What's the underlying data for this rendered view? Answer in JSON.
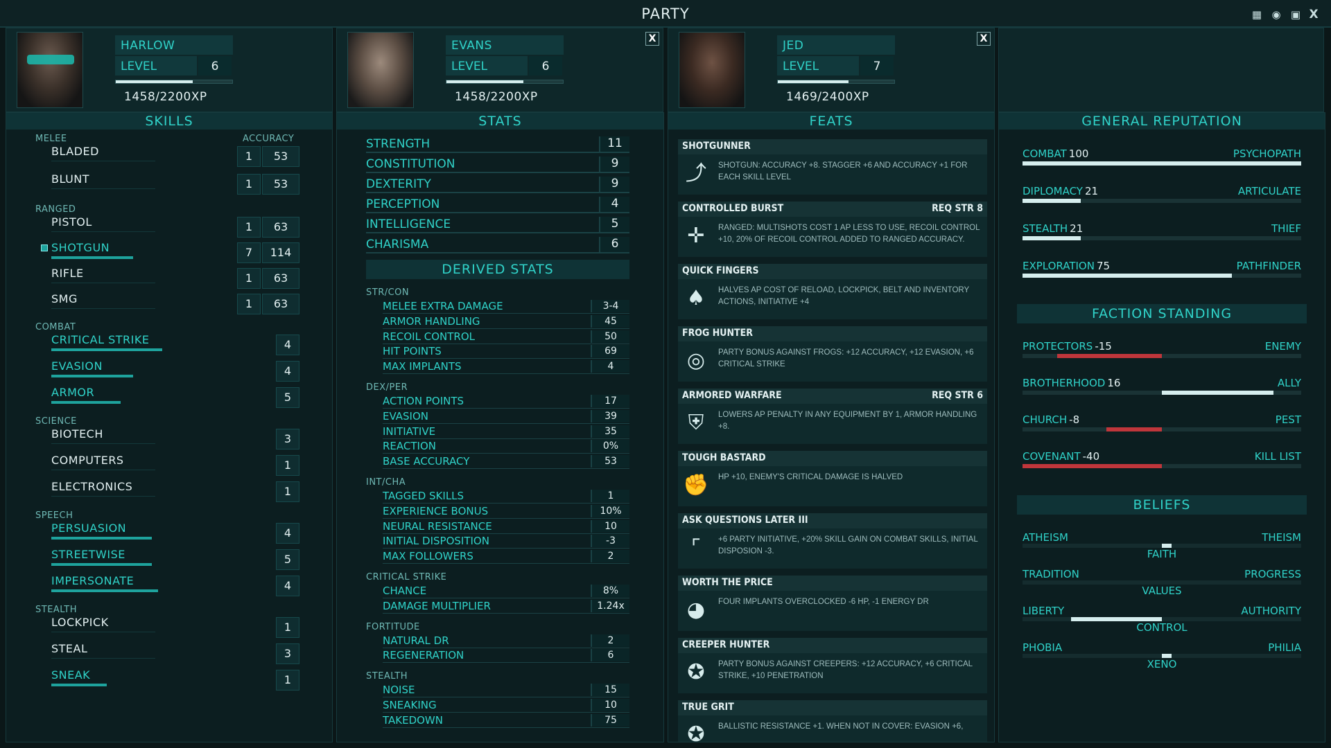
{
  "window": {
    "title": "PARTY",
    "icons": [
      "calendar-icon",
      "brain-icon",
      "monitor-icon",
      "close-icon"
    ],
    "close_label": "X"
  },
  "party": [
    {
      "name": "HARLOW",
      "level_label": "LEVEL",
      "level": "6",
      "xp": "1458/2200XP",
      "xp_fraction": 0.66
    },
    {
      "name": "EVANS",
      "level_label": "LEVEL",
      "level": "6",
      "xp": "1458/2200XP",
      "xp_fraction": 0.66,
      "close": "X"
    },
    {
      "name": "JED",
      "level_label": "LEVEL",
      "level": "7",
      "xp": "1469/2400XP",
      "xp_fraction": 0.61,
      "close": "X"
    }
  ],
  "skills": {
    "title": "SKILLS",
    "accuracy_label": "ACCURACY",
    "groups": [
      {
        "name": "MELEE",
        "items": [
          {
            "label": "BLADED",
            "value": "1",
            "accuracy": "53",
            "tagged": false
          },
          {
            "label": "BLUNT",
            "value": "1",
            "accuracy": "53",
            "tagged": false
          }
        ]
      },
      {
        "name": "RANGED",
        "items": [
          {
            "label": "PISTOL",
            "value": "1",
            "accuracy": "63",
            "tagged": false
          },
          {
            "label": "SHOTGUN",
            "value": "7",
            "accuracy": "114",
            "tagged": true
          },
          {
            "label": "RIFLE",
            "value": "1",
            "accuracy": "63",
            "tagged": false
          },
          {
            "label": "SMG",
            "value": "1",
            "accuracy": "63",
            "tagged": false
          }
        ]
      },
      {
        "name": "COMBAT",
        "items": [
          {
            "label": "CRITICAL STRIKE",
            "value": "4",
            "tagged": true
          },
          {
            "label": "EVASION",
            "value": "4",
            "tagged": true
          },
          {
            "label": "ARMOR",
            "value": "5",
            "tagged": true
          }
        ]
      },
      {
        "name": "SCIENCE",
        "items": [
          {
            "label": "BIOTECH",
            "value": "3",
            "tagged": false
          },
          {
            "label": "COMPUTERS",
            "value": "1",
            "tagged": false
          },
          {
            "label": "ELECTRONICS",
            "value": "1",
            "tagged": false
          }
        ]
      },
      {
        "name": "SPEECH",
        "items": [
          {
            "label": "PERSUASION",
            "value": "4",
            "tagged": true
          },
          {
            "label": "STREETWISE",
            "value": "5",
            "tagged": true
          },
          {
            "label": "IMPERSONATE",
            "value": "4",
            "tagged": true
          }
        ]
      },
      {
        "name": "STEALTH",
        "items": [
          {
            "label": "LOCKPICK",
            "value": "1",
            "tagged": false
          },
          {
            "label": "STEAL",
            "value": "3",
            "tagged": false
          },
          {
            "label": "SNEAK",
            "value": "1",
            "tagged": true
          }
        ]
      }
    ]
  },
  "stats": {
    "title": "STATS",
    "primary": [
      {
        "label": "STRENGTH",
        "value": "11"
      },
      {
        "label": "CONSTITUTION",
        "value": "9"
      },
      {
        "label": "DEXTERITY",
        "value": "9"
      },
      {
        "label": "PERCEPTION",
        "value": "4"
      },
      {
        "label": "INTELLIGENCE",
        "value": "5"
      },
      {
        "label": "CHARISMA",
        "value": "6"
      }
    ],
    "derived_title": "DERIVED STATS",
    "derived": [
      {
        "group": "STR/CON",
        "items": [
          {
            "label": "MELEE EXTRA DAMAGE",
            "value": "3-4"
          },
          {
            "label": "ARMOR HANDLING",
            "value": "45"
          },
          {
            "label": "RECOIL CONTROL",
            "value": "50"
          },
          {
            "label": "HIT POINTS",
            "value": "69"
          },
          {
            "label": "MAX IMPLANTS",
            "value": "4"
          }
        ]
      },
      {
        "group": "DEX/PER",
        "items": [
          {
            "label": "ACTION POINTS",
            "value": "17"
          },
          {
            "label": "EVASION",
            "value": "39"
          },
          {
            "label": "INITIATIVE",
            "value": "35"
          },
          {
            "label": "REACTION",
            "value": "0%"
          },
          {
            "label": "BASE ACCURACY",
            "value": "53"
          }
        ]
      },
      {
        "group": "INT/CHA",
        "items": [
          {
            "label": "TAGGED SKILLS",
            "value": "1"
          },
          {
            "label": "EXPERIENCE BONUS",
            "value": "10%"
          },
          {
            "label": "NEURAL RESISTANCE",
            "value": "10"
          },
          {
            "label": "INITIAL DISPOSITION",
            "value": "-3"
          },
          {
            "label": "MAX FOLLOWERS",
            "value": "2"
          }
        ]
      },
      {
        "group": "CRITICAL STRIKE",
        "items": [
          {
            "label": "CHANCE",
            "value": "8%"
          },
          {
            "label": "DAMAGE MULTIPLIER",
            "value": "1.24x"
          }
        ]
      },
      {
        "group": "FORTITUDE",
        "items": [
          {
            "label": "NATURAL DR",
            "value": "2"
          },
          {
            "label": "REGENERATION",
            "value": "6"
          }
        ]
      },
      {
        "group": "STEALTH",
        "items": [
          {
            "label": "NOISE",
            "value": "15"
          },
          {
            "label": "SNEAKING",
            "value": "10"
          },
          {
            "label": "TAKEDOWN",
            "value": "75"
          }
        ]
      }
    ]
  },
  "feats": {
    "title": "FEATS",
    "items": [
      {
        "name": "SHOTGUNNER",
        "req": "",
        "icon": "shotgun-icon",
        "desc": "SHOTGUN: ACCURACY +8. STAGGER +6 AND ACCURACY +1 FOR EACH SKILL LEVEL"
      },
      {
        "name": "CONTROLLED BURST",
        "req": "REQ STR 8",
        "icon": "crosshair-icon",
        "desc": "RANGED: MULTISHOTS COST 1 AP LESS TO USE, RECOIL CONTROL +10, 20% OF RECOIL CONTROL ADDED TO RANGED ACCURACY."
      },
      {
        "name": "QUICK FINGERS",
        "req": "",
        "icon": "cards-icon",
        "desc": "HALVES AP COST OF RELOAD, LOCKPICK, BELT AND INVENTORY ACTIONS, INITIATIVE +4"
      },
      {
        "name": "FROG HUNTER",
        "req": "",
        "icon": "frog-target-icon",
        "desc": "PARTY BONUS AGAINST FROGS: +12 ACCURACY, +12 EVASION, +6 CRITICAL STRIKE"
      },
      {
        "name": "ARMORED WARFARE",
        "req": "REQ STR 6",
        "icon": "armor-icon",
        "desc": "LOWERS AP PENALTY IN ANY EQUIPMENT BY 1, ARMOR HANDLING +8."
      },
      {
        "name": "TOUGH BASTARD",
        "req": "",
        "icon": "fist-icon",
        "desc": "HP +10, ENEMY'S CRITICAL DAMAGE IS HALVED"
      },
      {
        "name": "ASK QUESTIONS LATER III",
        "req": "",
        "icon": "pistol-icon",
        "desc": "+6 PARTY INITIATIVE, +20% SKILL GAIN ON COMBAT SKILLS, INITIAL DISPOSION -3."
      },
      {
        "name": "WORTH THE PRICE",
        "req": "",
        "icon": "gauge-icon",
        "desc": "FOUR IMPLANTS OVERCLOCKED -6 HP, -1 ENERGY DR"
      },
      {
        "name": "CREEPER HUNTER",
        "req": "",
        "icon": "creeper-target-icon",
        "desc": "PARTY BONUS AGAINST CREEPERS: +12 ACCURACY, +6 CRITICAL STRIKE, +10 PENETRATION"
      },
      {
        "name": "TRUE GRIT",
        "req": "",
        "icon": "star-badge-icon",
        "desc": "BALLISTIC RESISTANCE +1. WHEN NOT IN COVER: EVASION +6,"
      }
    ]
  },
  "reputation": {
    "title": "GENERAL REPUTATION",
    "items": [
      {
        "label": "COMBAT",
        "value": "100",
        "title": "PSYCHOPATH",
        "fraction": 1.0
      },
      {
        "label": "DIPLOMACY",
        "value": "21",
        "title": "ARTICULATE",
        "fraction": 0.21
      },
      {
        "label": "STEALTH",
        "value": "21",
        "title": "THIEF",
        "fraction": 0.21
      },
      {
        "label": "EXPLORATION",
        "value": "75",
        "title": "PATHFINDER",
        "fraction": 0.75
      }
    ],
    "faction_title": "FACTION STANDING",
    "factions": [
      {
        "label": "PROTECTORS",
        "value": "-15",
        "status": "ENEMY",
        "fraction": -0.75
      },
      {
        "label": "BROTHERHOOD",
        "value": "16",
        "status": "ALLY",
        "fraction": 0.8
      },
      {
        "label": "CHURCH",
        "value": "-8",
        "status": "PEST",
        "fraction": -0.4
      },
      {
        "label": "COVENANT",
        "value": "-40",
        "status": "KILL LIST",
        "fraction": -1.0
      }
    ],
    "beliefs_title": "BELIEFS",
    "beliefs": [
      {
        "left": "ATHEISM",
        "right": "THEISM",
        "center": "FAITH",
        "from": 0.0,
        "to": 0.07
      },
      {
        "left": "TRADITION",
        "right": "PROGRESS",
        "center": "VALUES",
        "from": 0.0,
        "to": 0.0
      },
      {
        "left": "LIBERTY",
        "right": "AUTHORITY",
        "center": "CONTROL",
        "from": -0.65,
        "to": 0.0
      },
      {
        "left": "PHOBIA",
        "right": "PHILIA",
        "center": "XENO",
        "from": 0.0,
        "to": 0.07
      }
    ]
  },
  "colors": {
    "accent": "#30d3c9",
    "negative": "#c0363b",
    "bar": "#d6eeee"
  }
}
